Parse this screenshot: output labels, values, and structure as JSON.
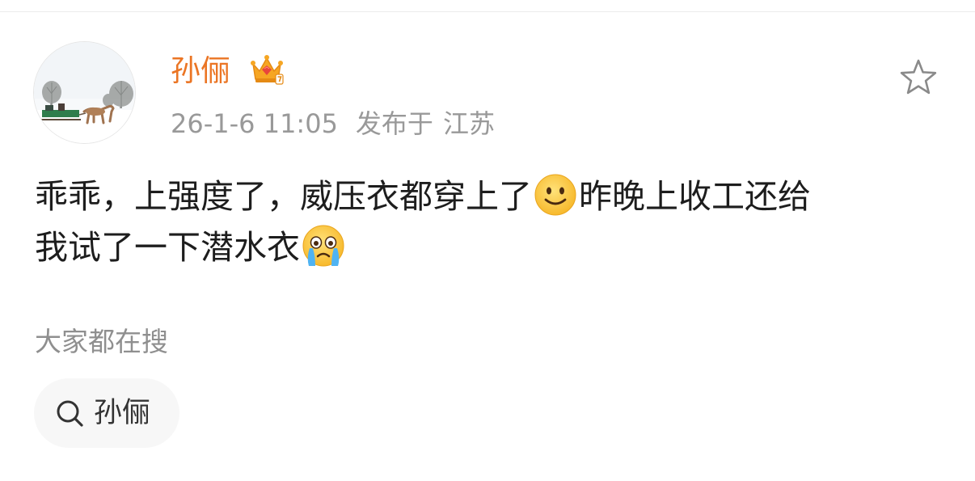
{
  "post": {
    "author": {
      "name": "孙俪",
      "badge_icon": "crown-badge-icon",
      "avatar_icon": "avatar-snow-sleigh-image"
    },
    "time": "26-1-6 11:05",
    "location_prefix": "发布于",
    "location": "江苏",
    "favorite_icon": "star-outline-icon",
    "text": {
      "line1_part1": "乖乖，上强度了，威压衣都穿上了",
      "emoji1": "smile-emoji-icon",
      "line1_part2": "昨晚上收工还给",
      "line2_part1": "我试了一下潜水衣",
      "emoji2": "crying-emoji-icon"
    }
  },
  "search_section": {
    "title": "大家都在搜",
    "chip": {
      "icon": "search-icon",
      "label": "孙俪"
    }
  },
  "colors": {
    "username": "#eb7524",
    "meta": "#999999",
    "body_text": "#1d1d1d",
    "chip_bg": "#f7f7f7"
  }
}
